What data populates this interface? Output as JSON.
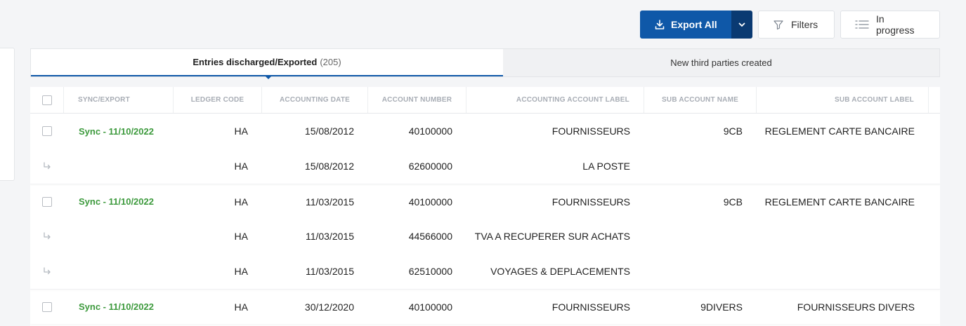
{
  "toolbar": {
    "export_label": "Export All",
    "filters_label": "Filters",
    "progress_label": "In progress"
  },
  "tabs": [
    {
      "label": "Entries discharged/Exported",
      "count": "(205)"
    },
    {
      "label": "New third parties created"
    }
  ],
  "columns": [
    "Sync/Export",
    "Ledger code",
    "Accounting date",
    "Account number",
    "Accounting account label",
    "Sub account name",
    "Sub account label"
  ],
  "rows": [
    {
      "sync": "Sync - 11/10/2022",
      "ledger": "HA",
      "date": "15/08/2012",
      "account": "40100000",
      "label": "FOURNISSEURS",
      "sub_name": "9CB",
      "sub_label": "REGLEMENT CARTE BANCAIRE"
    },
    {
      "ledger": "HA",
      "date": "15/08/2012",
      "account": "62600000",
      "label": "LA POSTE"
    },
    {
      "sync": "Sync - 11/10/2022",
      "ledger": "HA",
      "date": "11/03/2015",
      "account": "40100000",
      "label": "FOURNISSEURS",
      "sub_name": "9CB",
      "sub_label": "REGLEMENT CARTE BANCAIRE"
    },
    {
      "ledger": "HA",
      "date": "11/03/2015",
      "account": "44566000",
      "label": "TVA A RECUPERER SUR ACHATS"
    },
    {
      "ledger": "HA",
      "date": "11/03/2015",
      "account": "62510000",
      "label": "VOYAGES & DEPLACEMENTS"
    },
    {
      "sync": "Sync - 11/10/2022",
      "ledger": "HA",
      "date": "30/12/2020",
      "account": "40100000",
      "label": "FOURNISSEURS",
      "sub_name": "9DIVERS",
      "sub_label": "FOURNISSEURS DIVERS"
    }
  ],
  "colors": {
    "primary": "#0f58a8",
    "primary_dark": "#0a3a72",
    "sync_green": "#3d9a3d"
  }
}
